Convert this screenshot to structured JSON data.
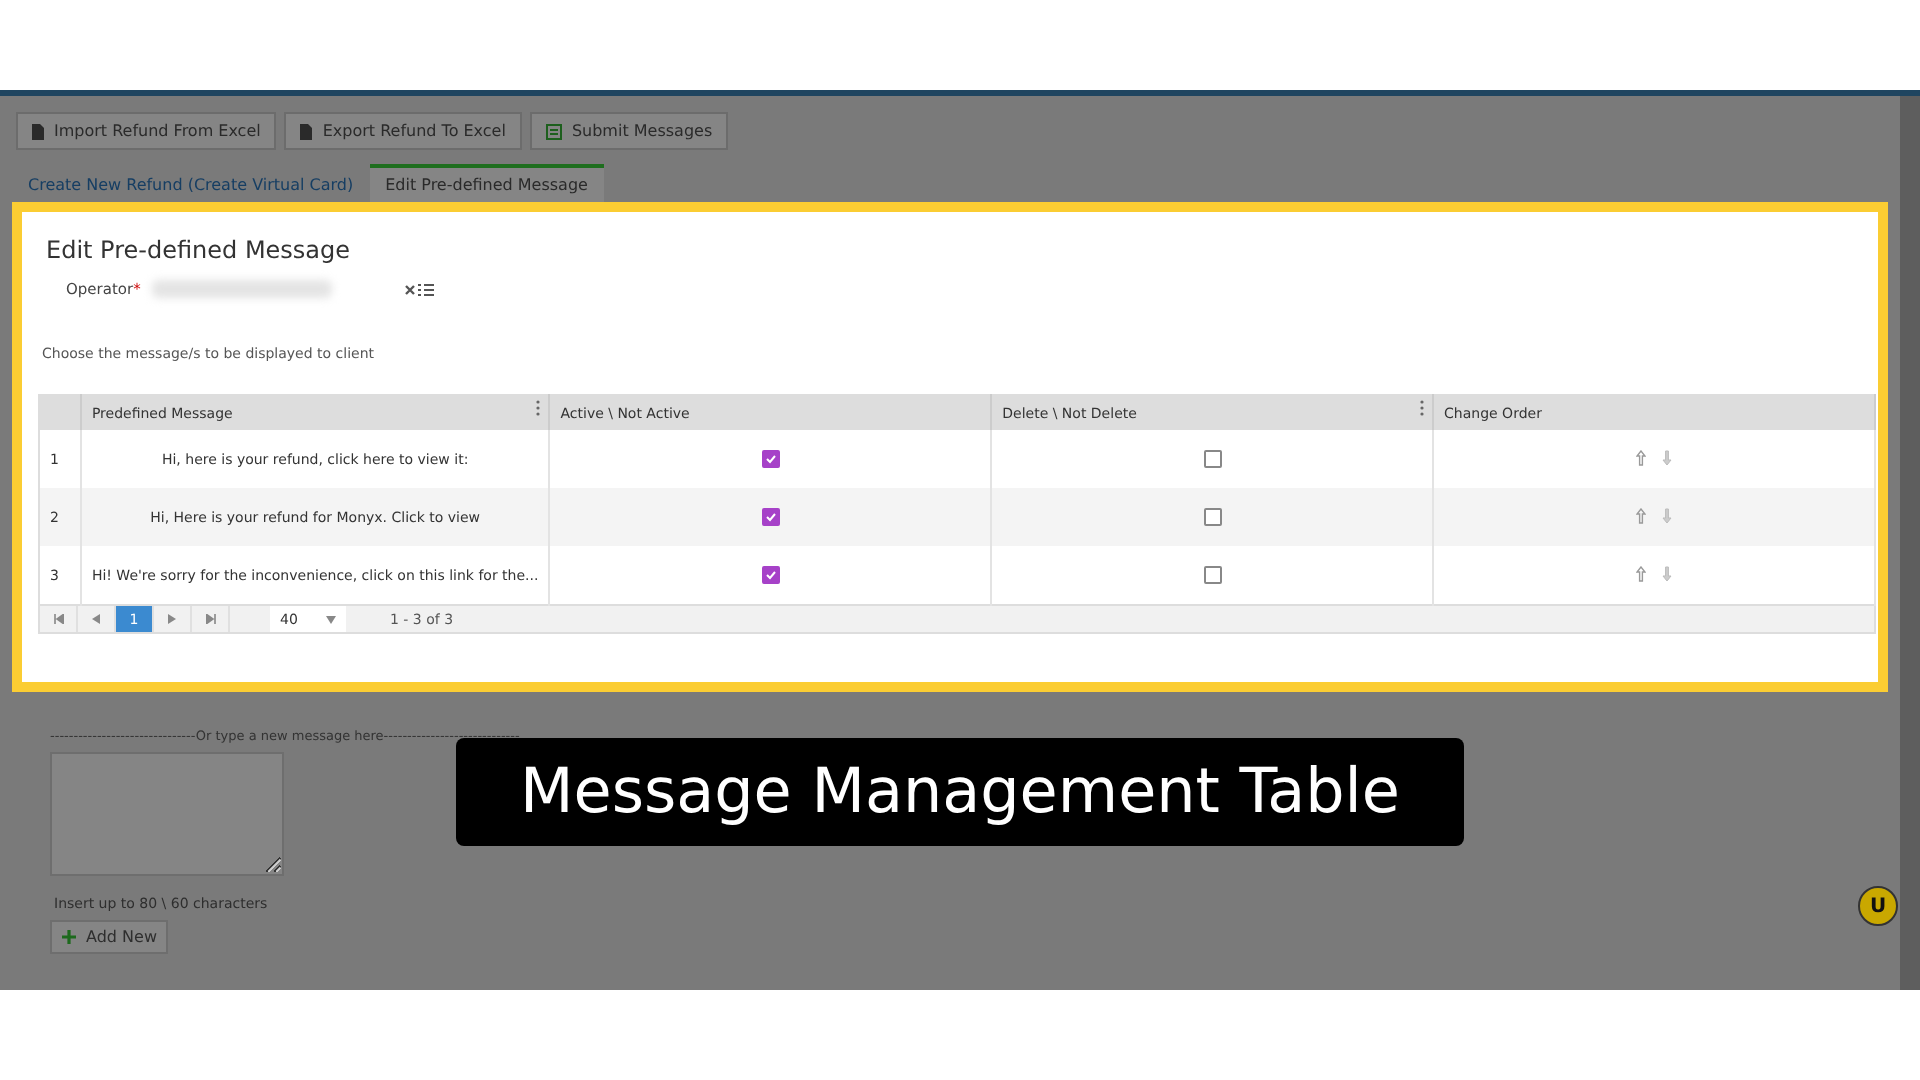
{
  "toolbar": [
    {
      "label": "Import Refund From Excel"
    },
    {
      "label": "Export Refund To Excel"
    },
    {
      "label": "Submit Messages"
    }
  ],
  "tabs": [
    {
      "label": "Create New Refund (Create Virtual Card)",
      "selected": false
    },
    {
      "label": "Edit Pre-defined Message",
      "selected": true
    }
  ],
  "panel": {
    "title": "Edit Pre-defined Message",
    "operator_label": "Operator",
    "operator_required_mark": "*",
    "hint": "Choose the message/s to be displayed to client",
    "columns": [
      "Predefined Message",
      "Active \\ Not Active",
      "Delete \\ Not Delete",
      "Change Order"
    ],
    "rows": [
      {
        "index": "1",
        "message": "Hi, here is your refund, click here to view it:",
        "active": true,
        "delete": false
      },
      {
        "index": "2",
        "message": "Hi, Here is your refund for Monyx. Click to view",
        "active": true,
        "delete": false
      },
      {
        "index": "3",
        "message": "Hi! We're sorry for the inconvenience, click on this link for the...",
        "active": true,
        "delete": false
      }
    ],
    "pager": {
      "pages": [
        {
          "label": "1",
          "selected": true
        }
      ],
      "page_size": "40",
      "summary": "1 - 3 of 3"
    }
  },
  "new_message": {
    "separator": "-------------------------------Or type a new message here-----------------------------",
    "limit_hint": "Insert up to 80 \\ 60 characters",
    "add_button": "Add New"
  },
  "caption": "Message Management Table",
  "badge": "U"
}
